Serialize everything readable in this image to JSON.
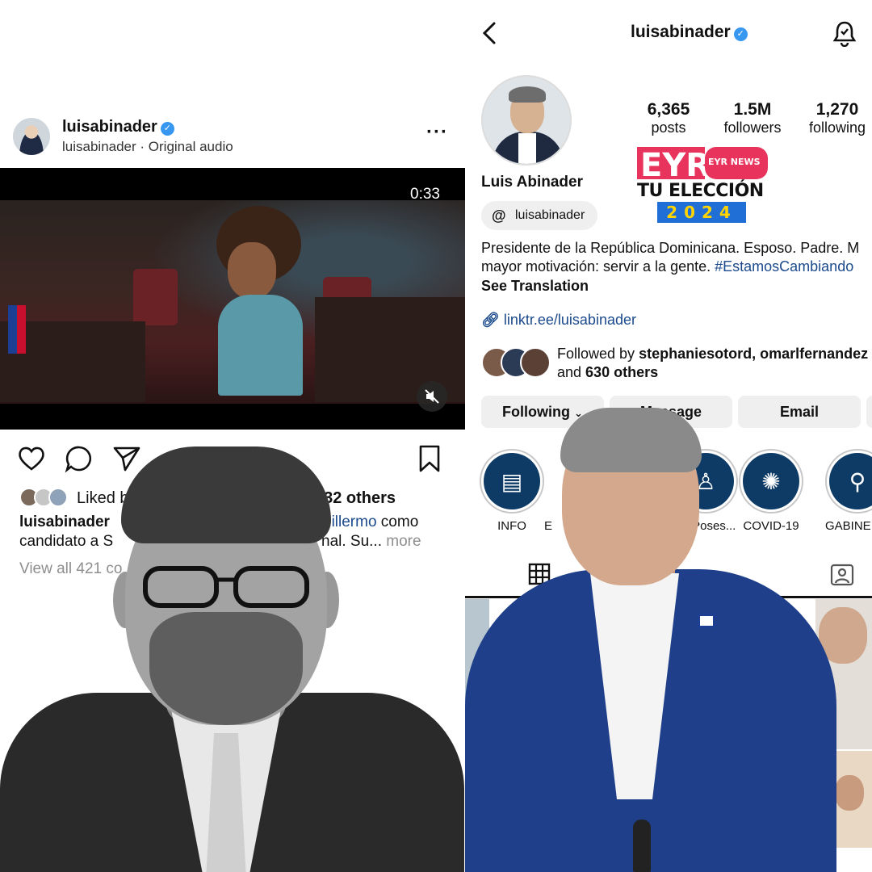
{
  "post": {
    "username": "luisabinader",
    "subtitle": "luisabinader · Original audio",
    "more_icon": "more-dots-icon",
    "video_time": "0:33",
    "mute_icon": "speaker-muted-icon",
    "actions": [
      "heart-icon",
      "comment-icon",
      "share-icon",
      "bookmark-icon"
    ],
    "liked_prefix": "Liked b",
    "liked_suffix": "632 others",
    "caption_user": "luisabinader",
    "caption_tag": "uillermo",
    "caption_after_tag": " como",
    "caption_line2_start": "candidato a S",
    "caption_line2_end": "nal. Su...",
    "caption_more": " more",
    "view_all": "View all 421 co"
  },
  "profile": {
    "title": "luisabinader",
    "stats": [
      {
        "value": "6,365",
        "label": "posts"
      },
      {
        "value": "1.5M",
        "label": "followers"
      },
      {
        "value": "1,270",
        "label": "following"
      }
    ],
    "display_name": "Luis Abinader",
    "threads_handle": "luisabinader",
    "bio_line1": "Presidente de la República Dominicana. Esposo. Padre. M",
    "bio_line2_text": "mayor motivación: servir a la gente. ",
    "bio_hashtag": "#EstamosCambiando",
    "see_translation": "See Translation",
    "link": "linktr.ee/luisabinader",
    "followed_by_prefix": "Followed by ",
    "followed_by_names": "stephaniesotord, omarlfernandez",
    "followed_by_and": "and ",
    "followed_by_others": "630 others",
    "buttons": {
      "following": "Following",
      "message": "Message",
      "email": "Email"
    },
    "highlights": [
      {
        "label": "INFO",
        "icon": "newspaper-icon"
      },
      {
        "label": "E",
        "icon": "blank"
      },
      {
        "label": "a Poses...",
        "icon": "podium-icon"
      },
      {
        "label": "COVID-19",
        "icon": "virus-icon"
      },
      {
        "label": "GABINE",
        "icon": "search-person-icon"
      }
    ]
  },
  "logo": {
    "brand": "EYR",
    "news": "EYR NEWS",
    "line": "TU ELECCIÓN",
    "year": "2024",
    "brand_color": "#e8345c",
    "year_bg": "#1f6fd6",
    "year_color": "#ffd400"
  },
  "colors": {
    "verified": "#3897f0",
    "link": "#1b4a8c",
    "button_bg": "#efefef",
    "highlight_bg": "#0d3b66"
  }
}
